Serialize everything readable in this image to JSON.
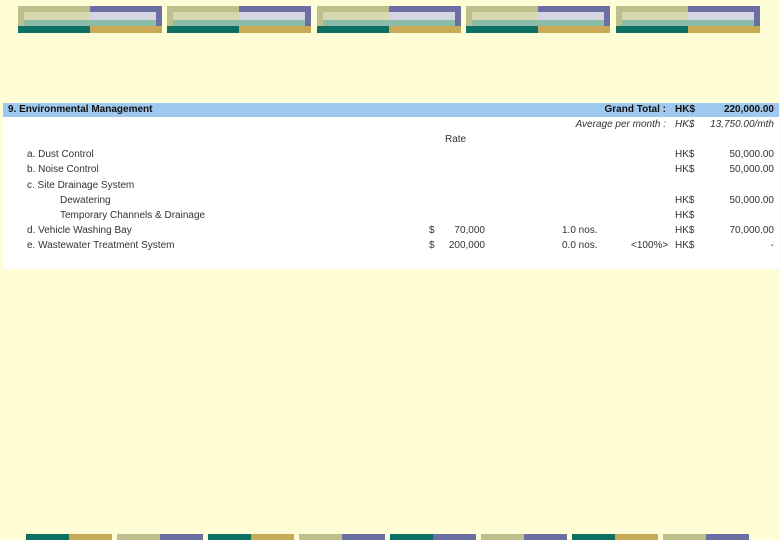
{
  "section": {
    "title": "9. Environmental Management",
    "grand_total_label": "Grand Total :",
    "grand_total_currency": "HK$",
    "grand_total_value": "220,000.00",
    "average_label": "Average per month :",
    "average_currency": "HK$",
    "average_value": "13,750.00/mth",
    "rate_header": "Rate"
  },
  "items": [
    {
      "label": "a. Dust Control",
      "rate_sym": "",
      "rate": "",
      "qty": "",
      "pct": "",
      "currency": "HK$",
      "amount": "50,000.00"
    },
    {
      "label": "b. Noise Control",
      "rate_sym": "",
      "rate": "",
      "qty": "",
      "pct": "",
      "currency": "HK$",
      "amount": "50,000.00"
    },
    {
      "label": "c. Site Drainage System",
      "rate_sym": "",
      "rate": "",
      "qty": "",
      "pct": "",
      "currency": "",
      "amount": ""
    },
    {
      "label": "Dewatering",
      "rate_sym": "",
      "rate": "",
      "qty": "",
      "pct": "",
      "currency": "HK$",
      "amount": "50,000.00"
    },
    {
      "label": "Temporary Channels & Drainage",
      "rate_sym": "",
      "rate": "",
      "qty": "",
      "pct": "",
      "currency": "HK$",
      "amount": ""
    },
    {
      "label": "d. Vehicle Washing Bay",
      "rate_sym": "$",
      "rate": "70,000",
      "qty": "1.0 nos.",
      "pct": "",
      "currency": "HK$",
      "amount": "70,000.00"
    },
    {
      "label": "e. Wastewater Treatment System",
      "rate_sym": "$",
      "rate": "200,000",
      "qty": "0.0 nos.",
      "pct": "<100%>",
      "currency": "HK$",
      "amount": "-"
    }
  ],
  "colors": {
    "background": "#fefdd6",
    "header_bar": "#9fc8ef"
  }
}
